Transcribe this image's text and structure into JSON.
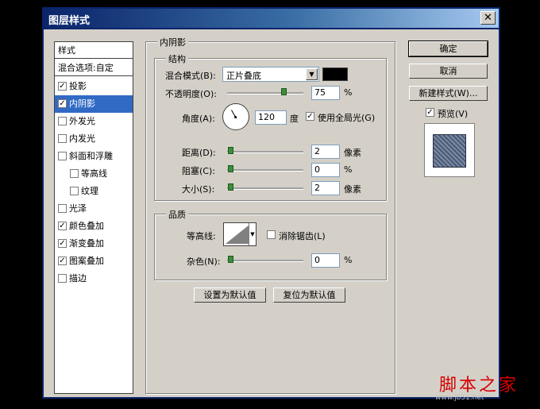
{
  "window": {
    "title": "图层样式",
    "close_glyph": "✕"
  },
  "sidebar": {
    "items": [
      {
        "label": "样式",
        "kind": "header"
      },
      {
        "label": "混合选项:自定",
        "kind": "header"
      },
      {
        "label": "投影",
        "checked": true
      },
      {
        "label": "内阴影",
        "checked": true,
        "selected": true
      },
      {
        "label": "外发光",
        "checked": false
      },
      {
        "label": "内发光",
        "checked": false
      },
      {
        "label": "斜面和浮雕",
        "checked": false
      },
      {
        "label": "等高线",
        "checked": false,
        "sub": true
      },
      {
        "label": "纹理",
        "checked": false,
        "sub": true
      },
      {
        "label": "光泽",
        "checked": false
      },
      {
        "label": "颜色叠加",
        "checked": true
      },
      {
        "label": "渐变叠加",
        "checked": true
      },
      {
        "label": "图案叠加",
        "checked": true
      },
      {
        "label": "描边",
        "checked": false
      }
    ]
  },
  "panel": {
    "title": "内阴影",
    "structure": {
      "title": "结构",
      "blend_mode_label": "混合模式(B):",
      "blend_mode_value": "正片叠底",
      "color": "#000000",
      "opacity_label": "不透明度(O):",
      "opacity_value": "75",
      "opacity_level": 0.75,
      "opacity_unit": "%",
      "angle_label": "角度(A):",
      "angle_value": "120",
      "angle_unit": "度",
      "global_light_label": "使用全局光(G)",
      "global_light_checked": true,
      "distance_label": "距离(D):",
      "distance_value": "2",
      "distance_unit": "像素",
      "choke_label": "阻塞(C):",
      "choke_value": "0",
      "choke_unit": "%",
      "size_label": "大小(S):",
      "size_value": "2",
      "size_unit": "像素"
    },
    "quality": {
      "title": "品质",
      "contour_label": "等高线:",
      "antialias_label": "消除锯齿(L)",
      "antialias_checked": false,
      "noise_label": "杂色(N):",
      "noise_value": "0",
      "noise_unit": "%"
    },
    "make_default_label": "设置为默认值",
    "reset_default_label": "复位为默认值"
  },
  "buttons": {
    "ok": "确定",
    "cancel": "取消",
    "new_style": "新建样式(W)...",
    "preview_label": "预览(V)",
    "preview_checked": true
  },
  "watermark": {
    "text": "脚本之家",
    "url": "www.jb51.net"
  }
}
